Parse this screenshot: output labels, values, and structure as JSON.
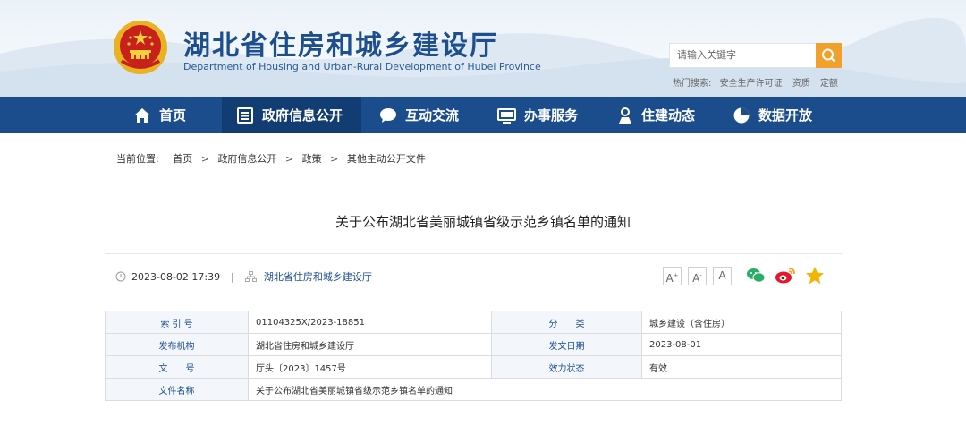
{
  "header": {
    "title": "湖北省住房和城乡建设厅",
    "subtitle": "Department of Housing and Urban-Rural Development of Hubei Province",
    "search_placeholder": "请输入关键字",
    "hot_label": "热门搜索:",
    "hot_terms": [
      "安全生产许可证",
      "资质",
      "定额"
    ]
  },
  "nav": {
    "items": [
      {
        "label": "首页",
        "icon": "home-icon"
      },
      {
        "label": "政府信息公开",
        "icon": "document-list-icon",
        "active": true
      },
      {
        "label": "互动交流",
        "icon": "chat-bubble-icon"
      },
      {
        "label": "办事服务",
        "icon": "monitor-icon"
      },
      {
        "label": "住建动态",
        "icon": "person-badge-icon"
      },
      {
        "label": "数据开放",
        "icon": "pie-chart-icon"
      }
    ]
  },
  "breadcrumb": {
    "label": "当前位置:",
    "items": [
      "首页",
      "政府信息公开",
      "政策",
      "其他主动公开文件"
    ]
  },
  "article": {
    "title": "关于公布湖北省美丽城镇省级示范乡镇名单的通知",
    "datetime": "2023-08-02 17:39",
    "source": "湖北省住房和城乡建设厅",
    "font_sizes": [
      "A+",
      "A-",
      "A"
    ]
  },
  "info": {
    "index_label": "索 引 号",
    "index_value": "01104325X/2023-18851",
    "category_label": "分　　类",
    "category_value": "城乡建设（含住房）",
    "issuer_label": "发布机构",
    "issuer_value": "湖北省住房和城乡建设厅",
    "date_label": "发文日期",
    "date_value": "2023-08-01",
    "docno_label": "文　　号",
    "docno_value": "厅头〔2023〕1457号",
    "status_label": "效力状态",
    "status_value": "有效",
    "filename_label": "文件名称",
    "filename_value": "关于公布湖北省美丽城镇省级示范乡镇名单的通知"
  },
  "colors": {
    "brand": "#1b4d8d",
    "brand_dark": "#123d73",
    "accent": "#f0a02b",
    "wechat": "#2aae67",
    "weibo": "#e6162d",
    "star": "#f5b400"
  }
}
